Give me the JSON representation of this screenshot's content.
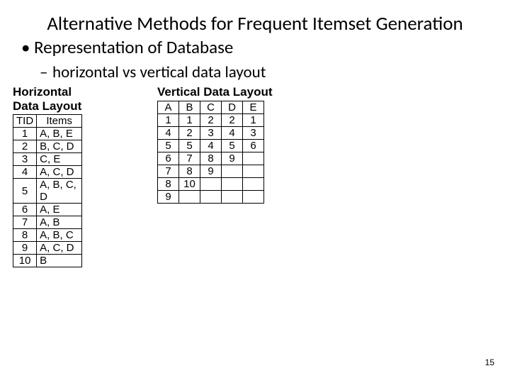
{
  "title": "Alternative Methods for Frequent Itemset Generation",
  "bullet": "Representation of Database",
  "subbullet": "horizontal vs vertical data layout",
  "horizontal": {
    "heading_l1": "Horizontal",
    "heading_l2": "Data Layout",
    "headers": {
      "tid": "TID",
      "items": "Items"
    },
    "rows": [
      {
        "tid": "1",
        "items": "A, B, E"
      },
      {
        "tid": "2",
        "items": "B, C, D"
      },
      {
        "tid": "3",
        "items": "C, E"
      },
      {
        "tid": "4",
        "items": "A, C, D"
      },
      {
        "tid": "5",
        "items": "A, B, C, D"
      },
      {
        "tid": "6",
        "items": "A, E"
      },
      {
        "tid": "7",
        "items": "A, B"
      },
      {
        "tid": "8",
        "items": "A, B, C"
      },
      {
        "tid": "9",
        "items": "A, C, D"
      },
      {
        "tid": "10",
        "items": "B"
      }
    ]
  },
  "vertical": {
    "heading": "Vertical Data Layout",
    "headers": [
      "A",
      "B",
      "C",
      "D",
      "E"
    ],
    "cols": {
      "A": [
        "1",
        "4",
        "5",
        "6",
        "7",
        "8",
        "9"
      ],
      "B": [
        "1",
        "2",
        "5",
        "7",
        "8",
        "10"
      ],
      "C": [
        "2",
        "3",
        "4",
        "8",
        "9"
      ],
      "D": [
        "2",
        "4",
        "5",
        "9"
      ],
      "E": [
        "1",
        "3",
        "6"
      ]
    },
    "maxrows": 7
  },
  "page_number": "15"
}
